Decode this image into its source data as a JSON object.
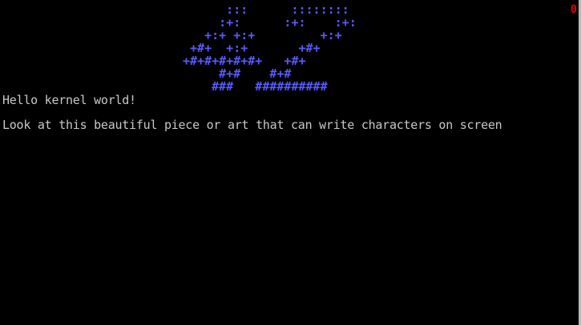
{
  "status": {
    "indicator": "0"
  },
  "ascii_art": {
    "lines": [
      "      :::      ::::::::",
      "     :+:      :+:    :+:",
      "   +:+ +:+         +:+",
      " +#+  +:+       +#+",
      "+#+#+#+#+#+   +#+",
      "     #+#    #+#",
      "    ###   ##########"
    ]
  },
  "console": {
    "lines": [
      "Hello kernel world!",
      "Look at this beautiful piece or art that can write characters on screen"
    ]
  },
  "colors": {
    "background": "#000000",
    "art": "#5a5aff",
    "text": "#c8c8c8",
    "indicator": "#e00000"
  }
}
